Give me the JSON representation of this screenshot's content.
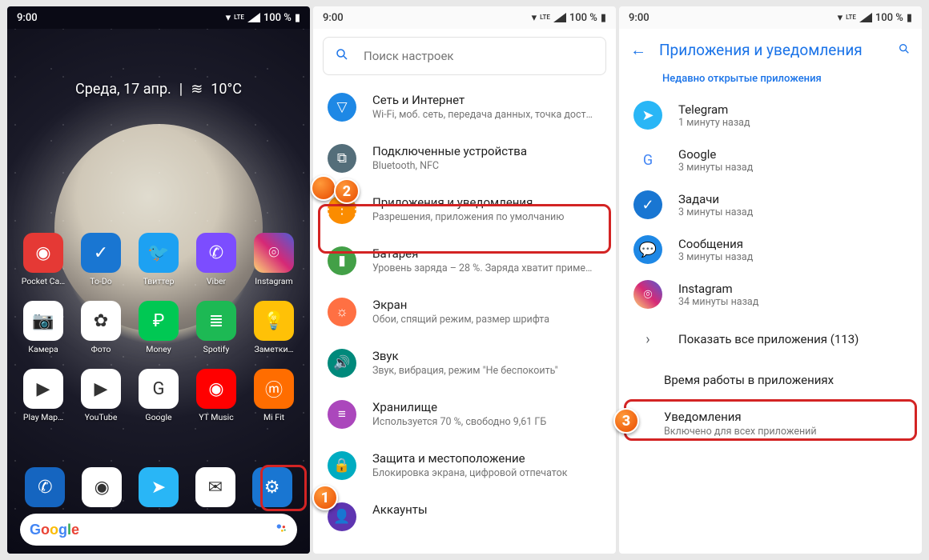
{
  "status": {
    "time": "9:00",
    "battery": "100 %",
    "net": "LTE"
  },
  "phone1": {
    "date": "Среда, 17 апр.",
    "weather": "10°C",
    "apps": [
      {
        "name": "Pocket Ca…",
        "bg": "#E53935",
        "ic": "◉"
      },
      {
        "name": "To-Do",
        "bg": "#1976D2",
        "ic": "✓"
      },
      {
        "name": "Твиттер",
        "bg": "#1DA1F2",
        "ic": "🐦"
      },
      {
        "name": "Viber",
        "bg": "#7C4DFF",
        "ic": "✆"
      },
      {
        "name": "Instagram",
        "bg": "linear-gradient(45deg,#feda75,#d62976,#4f5bd5)",
        "ic": "⌾"
      },
      {
        "name": "Камера",
        "bg": "#fff",
        "ic": "📷"
      },
      {
        "name": "Фото",
        "bg": "#fff",
        "ic": "✿"
      },
      {
        "name": "Money",
        "bg": "#00C853",
        "ic": "₽"
      },
      {
        "name": "Spotify",
        "bg": "#1DB954",
        "ic": "≣"
      },
      {
        "name": "Заметки…",
        "bg": "#FFC107",
        "ic": "💡"
      },
      {
        "name": "Play Мар…",
        "bg": "#fff",
        "ic": "▶"
      },
      {
        "name": "YouTube",
        "bg": "#fff",
        "ic": "▶"
      },
      {
        "name": "Google",
        "bg": "#fff",
        "ic": "G"
      },
      {
        "name": "YT Music",
        "bg": "#FF0000",
        "ic": "◉"
      },
      {
        "name": "Mi Fit",
        "bg": "#FF6D00",
        "ic": "ⓜ"
      }
    ],
    "dock": [
      {
        "name": "Phone",
        "bg": "#1565C0",
        "ic": "✆"
      },
      {
        "name": "Chrome",
        "bg": "#fff",
        "ic": "◉"
      },
      {
        "name": "Telegram",
        "bg": "#29B6F6",
        "ic": "➤"
      },
      {
        "name": "Gmail",
        "bg": "#fff",
        "ic": "✉"
      },
      {
        "name": "Settings",
        "bg": "#1976D2",
        "ic": "⚙"
      }
    ]
  },
  "phone2": {
    "search_placeholder": "Поиск настроек",
    "items": [
      {
        "title": "Сеть и Интернет",
        "sub": "Wi-Fi, моб. сеть, передача данных, точка дост…",
        "color": "#1E88E5",
        "ic": "▽"
      },
      {
        "title": "Подключенные устройства",
        "sub": "Bluetooth, NFC",
        "color": "#546E7A",
        "ic": "⧉"
      },
      {
        "title": "Приложения и уведомления",
        "sub": "Разрешения, приложения по умолчанию",
        "color": "#FB8C00",
        "ic": "⋮⋮⋮"
      },
      {
        "title": "Батарея",
        "sub": "Уровень заряда – 28 %. Заряда хватит приме…",
        "color": "#43A047",
        "ic": "▮"
      },
      {
        "title": "Экран",
        "sub": "Обои, спящий режим, размер шрифта",
        "color": "#FF7043",
        "ic": "☼"
      },
      {
        "title": "Звук",
        "sub": "Звук, вибрация, режим \"Не беспокоить\"",
        "color": "#00897B",
        "ic": "🔊"
      },
      {
        "title": "Хранилище",
        "sub": "Используется 70 %, свободно 9,61 ГБ",
        "color": "#AB47BC",
        "ic": "≡"
      },
      {
        "title": "Защита и местоположение",
        "sub": "Блокировка экрана, цифровой отпечаток",
        "color": "#00ACC1",
        "ic": "🔒"
      },
      {
        "title": "Аккаунты",
        "sub": "",
        "color": "#5E35B1",
        "ic": "👤"
      }
    ]
  },
  "phone3": {
    "title": "Приложения и уведомления",
    "section": "Недавно открытые приложения",
    "recent": [
      {
        "name": "Telegram",
        "sub": "1 минуту назад",
        "bg": "#29B6F6",
        "ic": "➤"
      },
      {
        "name": "Google",
        "sub": "3 минуты назад",
        "bg": "#fff",
        "ic": "G"
      },
      {
        "name": "Задачи",
        "sub": "3 минуты назад",
        "bg": "#1976D2",
        "ic": "✓"
      },
      {
        "name": "Сообщения",
        "sub": "3 минуты назад",
        "bg": "#1E88E5",
        "ic": "💬"
      },
      {
        "name": "Instagram",
        "sub": "34 минуты назад",
        "bg": "linear-gradient(45deg,#feda75,#d62976,#4f5bd5)",
        "ic": "⌾"
      }
    ],
    "show_all": "Показать все приложения (113)",
    "screen_time": "Время работы в приложениях",
    "notifications_title": "Уведомления",
    "notifications_sub": "Включено для всех приложений"
  }
}
